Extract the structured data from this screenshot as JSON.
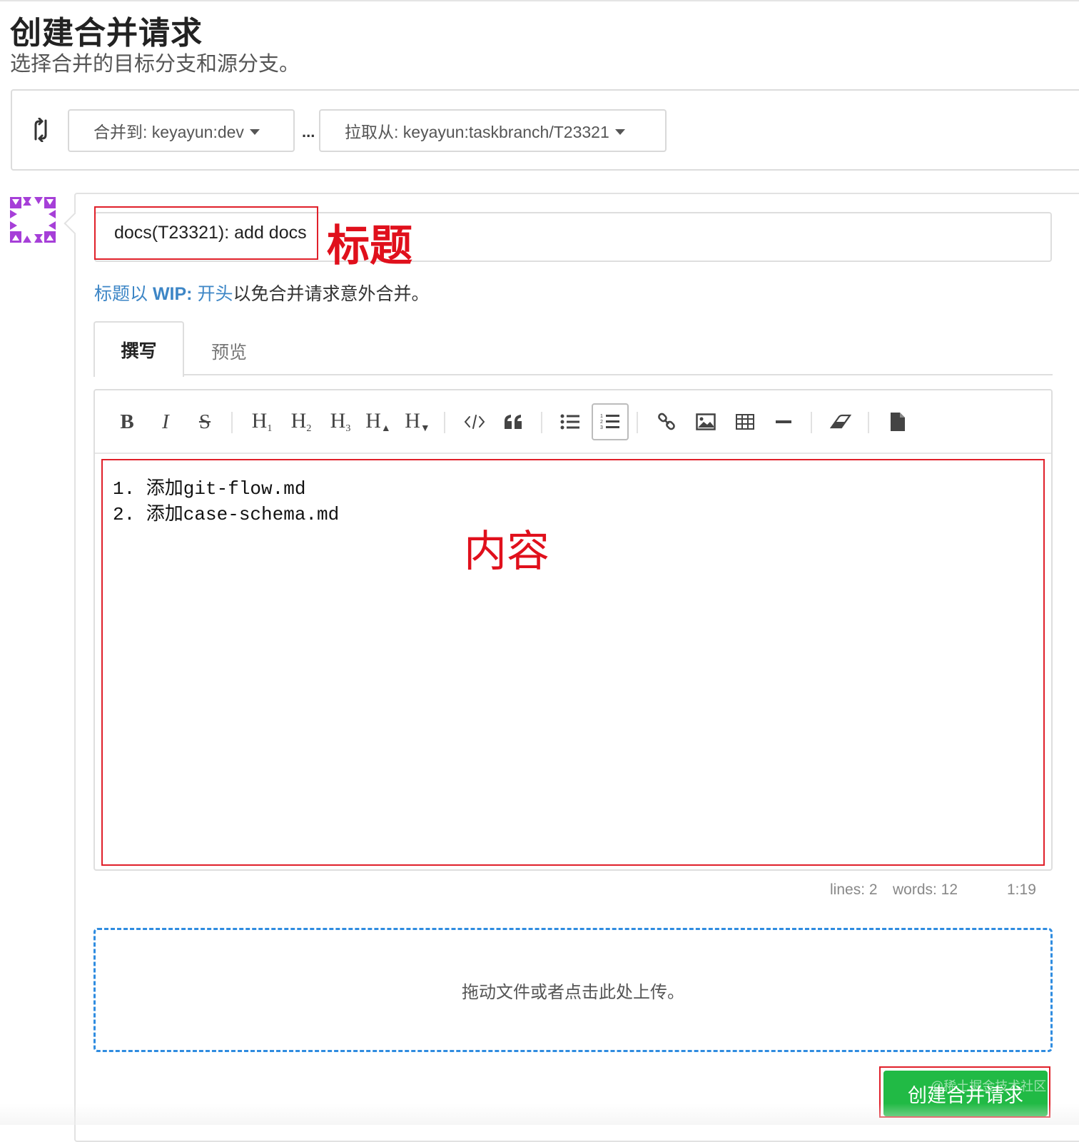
{
  "header": {
    "title": "创建合并请求",
    "subtitle": "选择合并的目标分支和源分支。"
  },
  "branches": {
    "target_label": "合并到: keyayun:dev",
    "separator": "...",
    "source_label": "拉取从: keyayun:taskbranch/T23321"
  },
  "form": {
    "title_value": "docs(T23321): add docs",
    "title_annotation": "标题",
    "wip_hint_prefix": "标题以 ",
    "wip_hint_keyword": "WIP:",
    "wip_hint_link_end": " 开头",
    "wip_hint_suffix": "以免合并请求意外合并。",
    "tabs": [
      "撰写",
      "预览"
    ]
  },
  "toolbar": {
    "bold": "B",
    "italic": "I",
    "strike": "S",
    "h1": "H",
    "h1_sub": "1",
    "h2": "H",
    "h2_sub": "2",
    "h3": "H",
    "h3_sub": "3",
    "hbigger": "H",
    "hbigger_sub": "▲",
    "hsmaller": "H",
    "hsmaller_sub": "▼",
    "icons": [
      "code-icon",
      "quote-icon",
      "unordered-list-icon",
      "ordered-list-icon",
      "link-icon",
      "image-icon",
      "table-icon",
      "horizontal-rule-icon",
      "eraser-icon",
      "file-icon"
    ]
  },
  "editor": {
    "lines": [
      "1. 添加git-flow.md",
      "2. 添加case-schema.md"
    ],
    "content_annotation": "内容",
    "status_lines": "lines: 2",
    "status_words": "words: 12",
    "status_cursor": "1:19"
  },
  "upload": {
    "text": "拖动文件或者点击此处上传。"
  },
  "submit": {
    "label": "创建合并请求",
    "watermark": "@稀土掘金技术社区"
  },
  "colors": {
    "accent_blue": "#3d86c6",
    "submit_green": "#21ba45",
    "annotation_red": "#e0202a",
    "dropzone_border": "#2f8ce0"
  }
}
